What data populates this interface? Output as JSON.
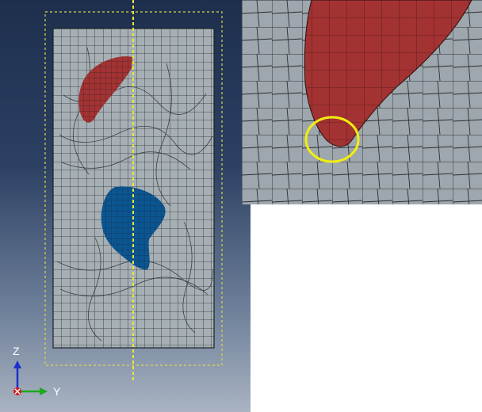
{
  "viewport": {
    "triad": {
      "z_label": "Z",
      "y_label": "Y"
    },
    "colors": {
      "background_top": "#1e2f4d",
      "background_bottom": "#a9b3c2",
      "mesh_fill": "#a6afb4",
      "mesh_lines": "#2a2f33",
      "part_red": "#a33232",
      "part_blue": "#0b5591",
      "guide_lines": "#e8e83a"
    }
  },
  "inset": {
    "colors": {
      "mesh_fill": "#9ea7ad",
      "part_red": "#a33232",
      "highlight_circle": "#f2ee10"
    }
  }
}
